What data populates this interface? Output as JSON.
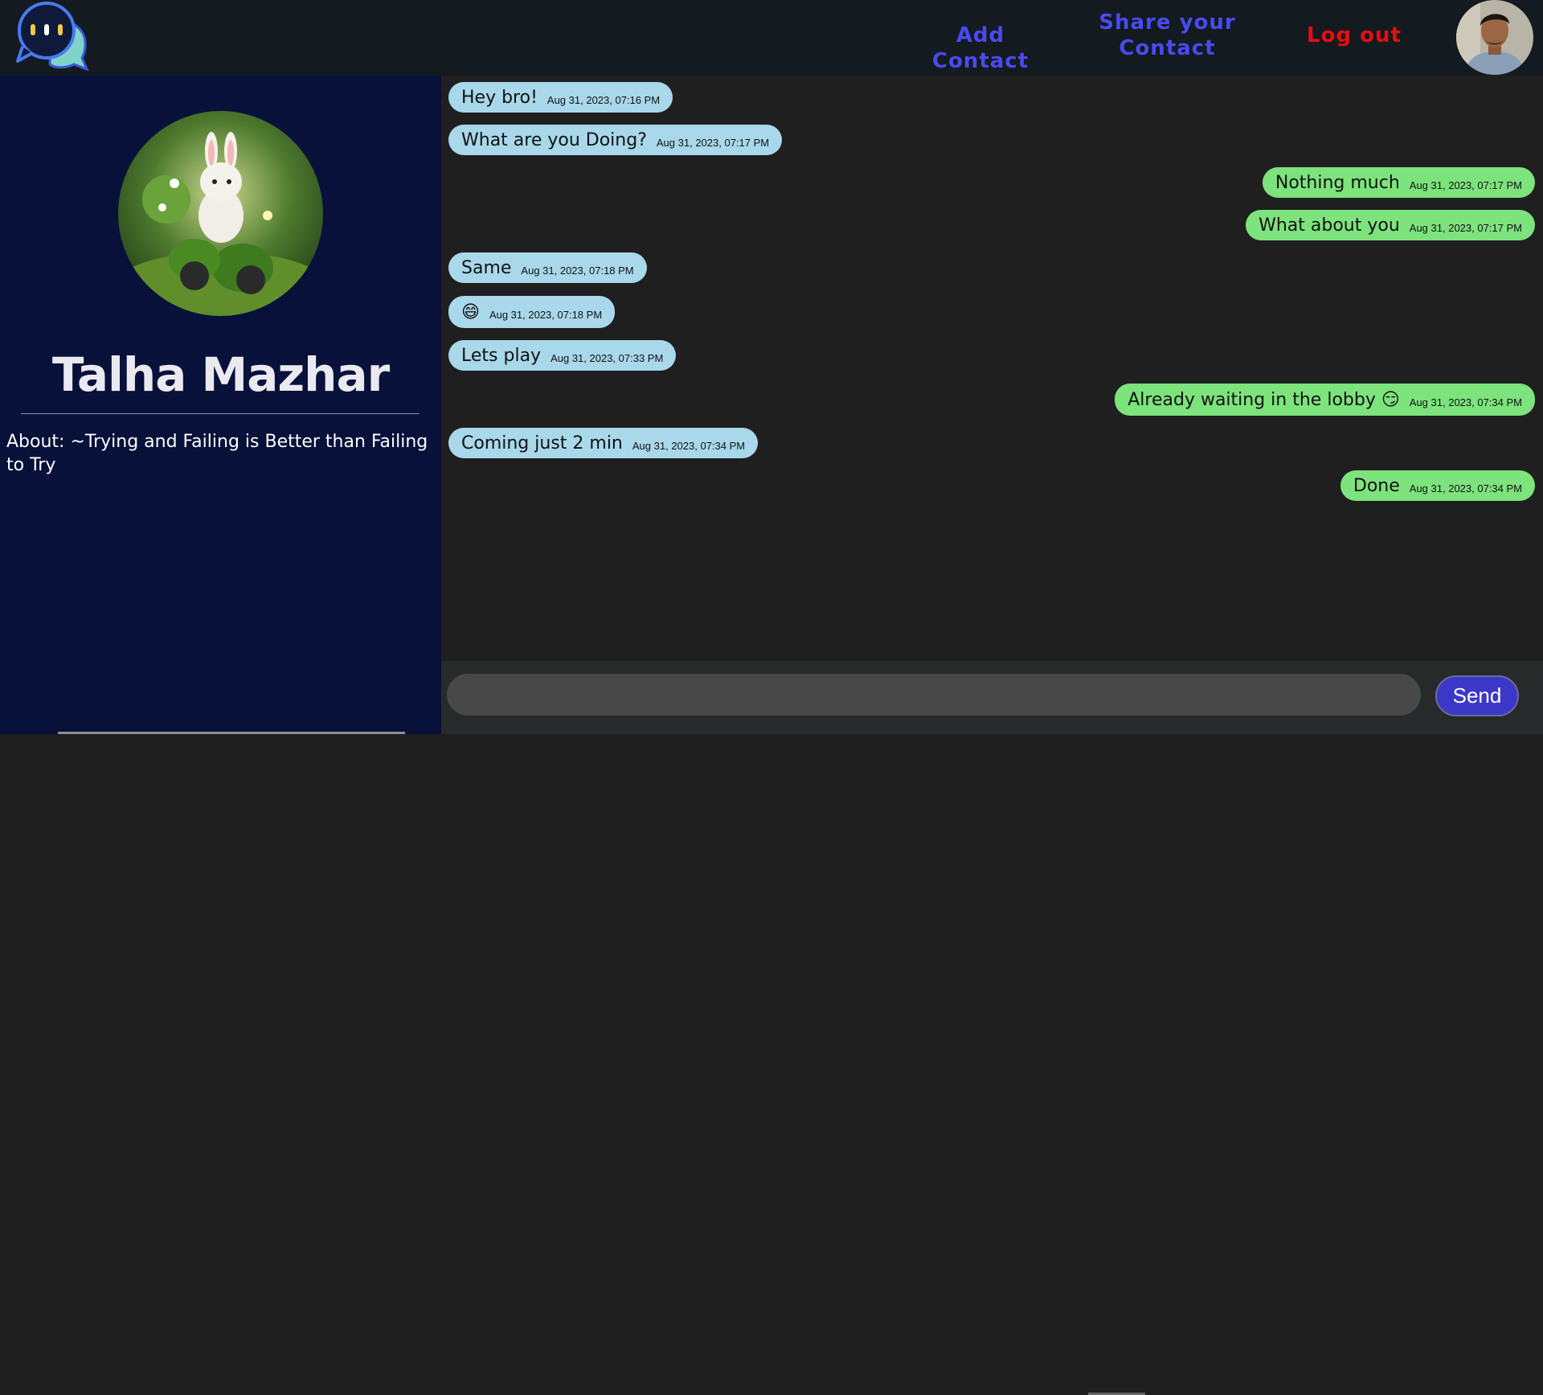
{
  "header": {
    "nav": {
      "add_contact": "Add Contact",
      "share_contact": "Share your Contact",
      "logout": "Log out"
    }
  },
  "profile": {
    "name": "Talha Mazhar",
    "about": "About: ~Trying and Failing is Better than Failing to Try"
  },
  "messages": [
    {
      "dir": "in",
      "text": "Hey bro!",
      "time": "Aug 31, 2023, 07:16 PM"
    },
    {
      "dir": "in",
      "text": "What are you Doing?",
      "time": "Aug 31, 2023, 07:17 PM"
    },
    {
      "dir": "out",
      "text": "Nothing much",
      "time": "Aug 31, 2023, 07:17 PM"
    },
    {
      "dir": "out",
      "text": "What about you",
      "time": "Aug 31, 2023, 07:17 PM"
    },
    {
      "dir": "in",
      "text": "Same",
      "time": "Aug 31, 2023, 07:18 PM"
    },
    {
      "dir": "in",
      "text": "😄",
      "time": "Aug 31, 2023, 07:18 PM"
    },
    {
      "dir": "in",
      "text": "Lets play",
      "time": "Aug 31, 2023, 07:33 PM"
    },
    {
      "dir": "out",
      "text": "Already waiting in the lobby 😏",
      "time": "Aug 31, 2023, 07:34 PM"
    },
    {
      "dir": "in",
      "text": "Coming just 2 min",
      "time": "Aug 31, 2023, 07:34 PM"
    },
    {
      "dir": "out",
      "text": "Done",
      "time": "Aug 31, 2023, 07:34 PM"
    }
  ],
  "composer": {
    "placeholder": "",
    "send_label": "Send"
  },
  "colors": {
    "incoming_bubble": "#a8d8ea",
    "outgoing_bubble": "#7de37d",
    "nav_link": "#4a4af0",
    "logout": "#e80d0d",
    "send_button": "#3b38c8"
  }
}
